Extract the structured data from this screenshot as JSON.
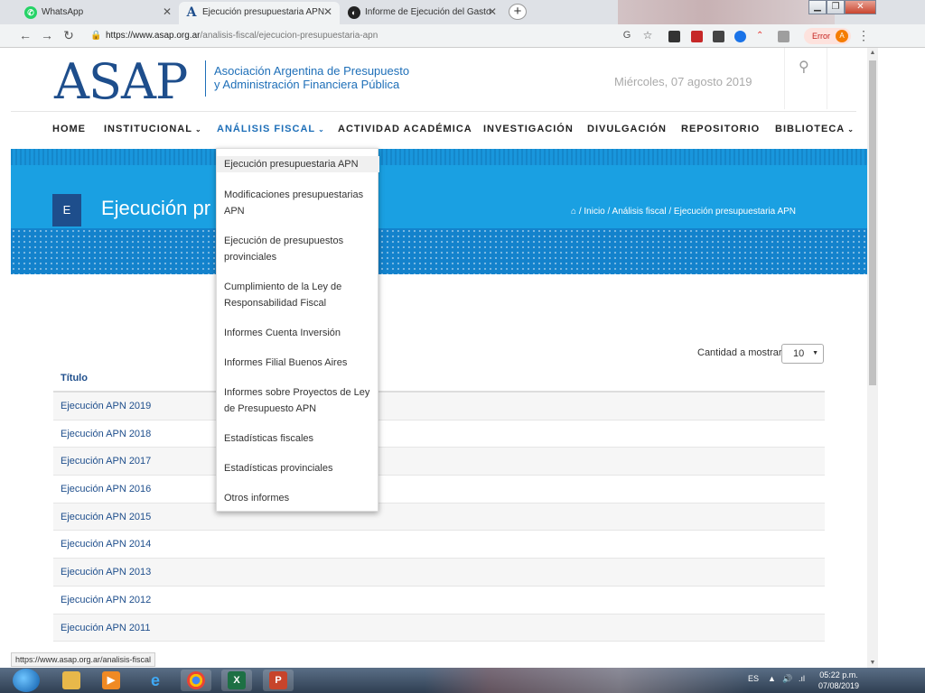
{
  "browser": {
    "tabs": [
      {
        "title": "WhatsApp",
        "icon": "whatsapp-icon",
        "active": false
      },
      {
        "title": "Ejecución presupuestaria APN",
        "icon": "asap-icon",
        "active": true
      },
      {
        "title": "Informe de Ejecución del Gasto",
        "icon": "site-icon",
        "active": false
      }
    ],
    "url_host": "https://www.asap.org.ar",
    "url_path": "/analisis-fiscal/ejecucion-presupuestaria-apn",
    "error_label": "Error",
    "avatar_letter": "A"
  },
  "header": {
    "logo": "ASAP",
    "logo_sub_1": "Asociación Argentina de Presupuesto",
    "logo_sub_2": "y Administración Financiera Pública",
    "date": "Miércoles, 07 agosto 2019"
  },
  "nav": {
    "items": [
      "HOME",
      "INSTITUCIONAL",
      "ANÁLISIS FISCAL",
      "ACTIVIDAD ACADÉMICA",
      "INVESTIGACIÓN",
      "DIVULGACIÓN",
      "REPOSITORIO",
      "BIBLIOTECA"
    ]
  },
  "banner": {
    "badge": "E",
    "title": "Ejecución pr",
    "breadcrumb": [
      "Inicio",
      "Análisis fiscal",
      "Ejecución presupuestaria APN"
    ]
  },
  "dropdown": {
    "items": [
      [
        "Ejecución presupuestaria APN"
      ],
      [
        "Modificaciones presupuestarias",
        "APN"
      ],
      [
        "Ejecución de presupuestos",
        "provinciales"
      ],
      [
        "Cumplimiento de la Ley de",
        "Responsabilidad Fiscal"
      ],
      [
        "Informes Cuenta Inversión"
      ],
      [
        "Informes Filial Buenos Aires"
      ],
      [
        "Informes sobre Proyectos de Ley",
        "de Presupuesto APN"
      ],
      [
        "Estadísticas fiscales"
      ],
      [
        "Estadísticas provinciales"
      ],
      [
        "Otros informes"
      ]
    ]
  },
  "list": {
    "show_label": "Cantidad a mostrar",
    "show_value": "10",
    "header": "Título",
    "rows": [
      "Ejecución APN 2019",
      "Ejecución APN 2018",
      "Ejecución APN 2017",
      "Ejecución APN 2016",
      "Ejecución APN 2015",
      "Ejecución APN 2014",
      "Ejecución APN 2013",
      "Ejecución APN 2012",
      "Ejecución APN 2011"
    ]
  },
  "status_url": "https://www.asap.org.ar/analisis-fiscal",
  "taskbar": {
    "lang": "ES",
    "time": "05:22 p.m.",
    "date": "07/08/2019"
  }
}
